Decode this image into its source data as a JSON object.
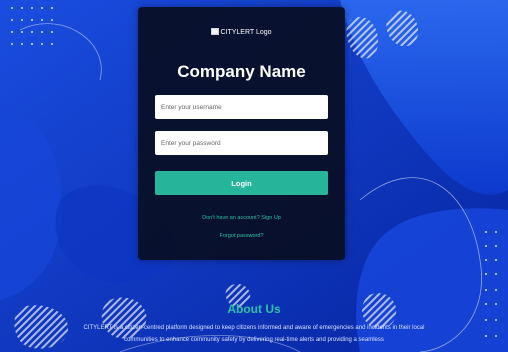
{
  "colors": {
    "background": "#0a2ca8",
    "card": "#080e22",
    "accent": "#26b59a",
    "link": "#27c0a1",
    "about_heading": "#2cc1a6"
  },
  "logo": {
    "alt_text": "CITYLERT Logo"
  },
  "company_name": "Company Name",
  "form": {
    "username_placeholder": "Enter your username",
    "password_placeholder": "Enter your password",
    "login_label": "Login",
    "signup_text": "Don't have an account? Sign Up",
    "forgot_text": "Forgot password?"
  },
  "about": {
    "heading": "About Us",
    "body": "CITYLERT is a citizen-centred platform designed to keep citizens informed and aware of emergencies and incidents in their local communities to enhance community safety by delivering real-time alerts and providing a seamless"
  },
  "icons": [
    "broken-image-icon"
  ]
}
